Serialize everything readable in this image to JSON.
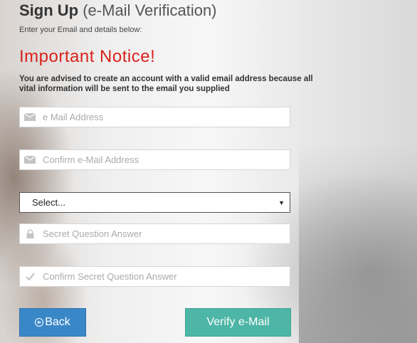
{
  "header": {
    "title_bold": "Sign Up",
    "title_rest": "(e-Mail Verification)",
    "subtitle": "Enter your Email and details below:"
  },
  "notice": {
    "heading": "Important Notice!",
    "line1": "You are advised to create an account with a valid email address because all",
    "line2": "vital information will be sent to the email you supplied"
  },
  "form": {
    "email": {
      "placeholder": "e Mail Address",
      "value": "",
      "icon": "envelope-icon"
    },
    "confirm_email": {
      "placeholder": "Confirm e-Mail Address",
      "value": "",
      "icon": "envelope-icon"
    },
    "secret_question": {
      "selected": "Select..."
    },
    "secret_answer": {
      "placeholder": "Secret Question Answer",
      "value": "",
      "icon": "lock-icon"
    },
    "confirm_answer": {
      "placeholder": "Confirm Secret Question Answer",
      "value": "",
      "icon": "check-icon"
    }
  },
  "buttons": {
    "back": "Back",
    "verify": "Verify e-Mail"
  },
  "colors": {
    "notice_red": "#d9231d",
    "back_blue": "#3a87c8",
    "verify_teal": "#4db6a6"
  }
}
